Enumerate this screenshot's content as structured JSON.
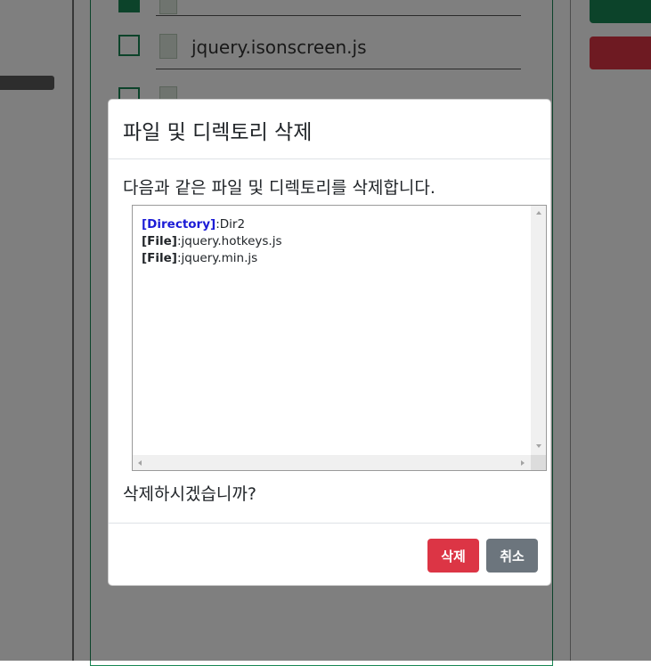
{
  "background": {
    "files": [
      {
        "name": "",
        "checked": true
      },
      {
        "name": "jquery.isonscreen.js",
        "checked": false
      },
      {
        "name": "",
        "checked": false
      }
    ],
    "colors": {
      "accent_green": "#198754",
      "danger_red": "#dc3545"
    }
  },
  "modal": {
    "title": "파일 및 디렉토리 삭제",
    "prompt": "다음과 같은 파일 및 디렉토리를 삭제합니다.",
    "items": [
      {
        "tag": "[Directory]",
        "type": "directory",
        "name": "Dir2"
      },
      {
        "tag": "[File]",
        "type": "file",
        "name": "jquery.hotkeys.js"
      },
      {
        "tag": "[File]",
        "type": "file",
        "name": "jquery.min.js"
      }
    ],
    "confirm_question": "삭제하시겠습니까?",
    "delete_label": "삭제",
    "cancel_label": "취소"
  }
}
